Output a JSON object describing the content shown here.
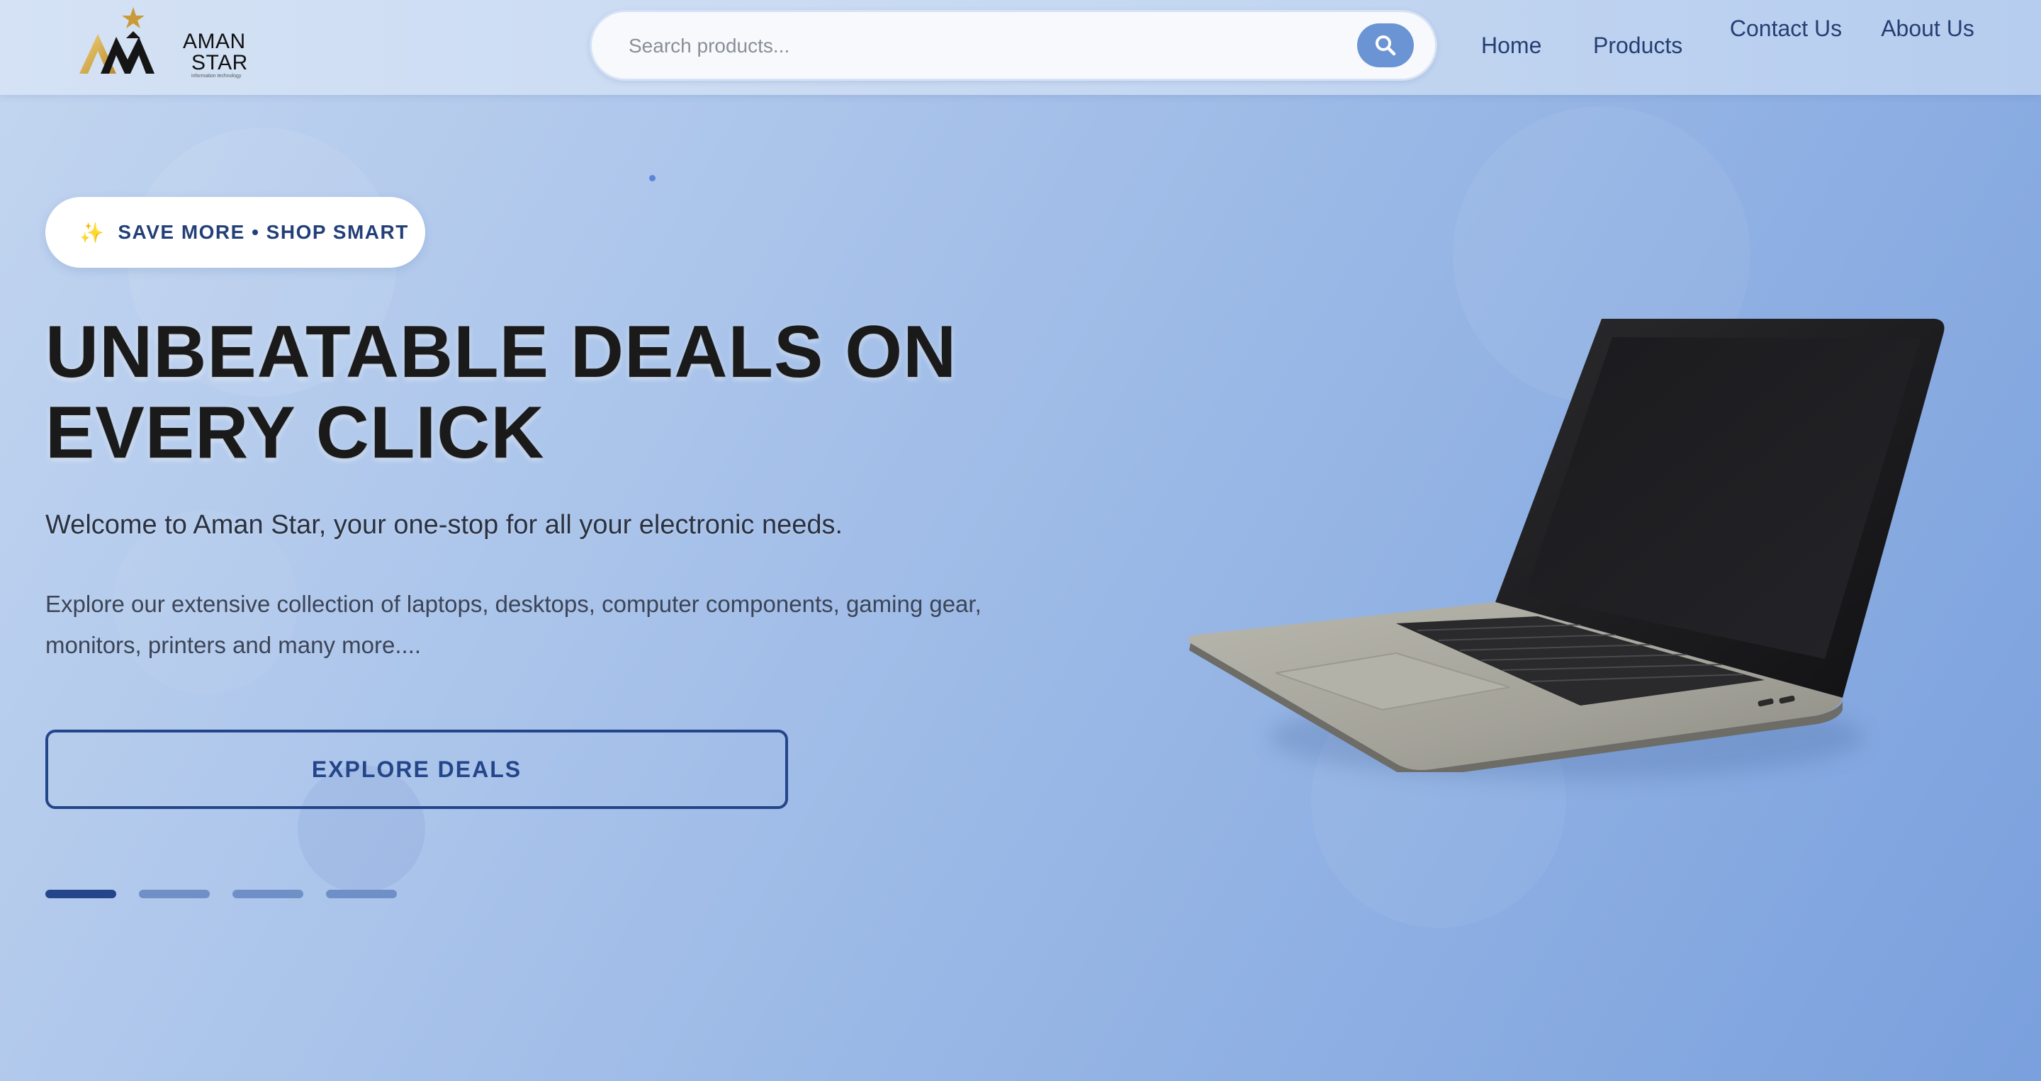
{
  "brand": {
    "name_line1": "AMAN",
    "name_line2": "STAR",
    "tagline": "information technology",
    "logo_icon": "mountain-star-logo"
  },
  "search": {
    "placeholder": "Search products...",
    "value": "",
    "button_icon": "search-icon"
  },
  "nav": {
    "items": [
      {
        "label": "Home"
      },
      {
        "label": "Products"
      },
      {
        "label": "Contact Us"
      },
      {
        "label": "About Us"
      }
    ]
  },
  "hero": {
    "badge": {
      "icon": "sparkles-icon",
      "label": "SAVE MORE • SHOP SMART"
    },
    "headline_line1": "UNBEATABLE DEALS ON",
    "headline_line2": "EVERY CLICK",
    "subheading": "Welcome to Aman Star, your one-stop for all your electronic needs.",
    "description": "Explore our extensive collection of laptops, desktops, computer components, gaming gear, monitors, printers and many more....",
    "cta_label": "EXPLORE DEALS",
    "slides": {
      "count": 4,
      "active_index": 0
    },
    "image": "laptop-image"
  },
  "colors": {
    "accent": "#24458a",
    "search_button": "#6b94d4",
    "badge_spark": "#e3b53a",
    "headline": "#1a1a1a"
  }
}
